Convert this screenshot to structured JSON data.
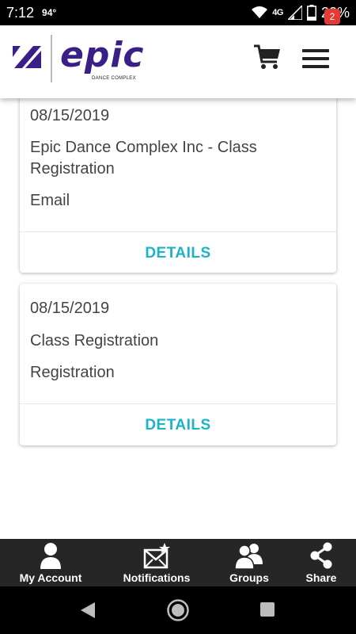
{
  "status_bar": {
    "time": "7:12",
    "temperature": "94°",
    "network": "4G",
    "battery": "22%"
  },
  "header": {
    "logo_text": "epic",
    "logo_subtext": "DANCE COMPLEX",
    "cart_icon": "cart-icon",
    "menu_icon": "hamburger-menu-icon",
    "badge_count": "2"
  },
  "cards": [
    {
      "date": "08/15/2019",
      "title_line1": "Epic Dance Complex Inc - Class",
      "title_line2": "Registration",
      "type": "Email",
      "action": "DETAILS"
    },
    {
      "date": "08/15/2019",
      "title_line1": "Class Registration",
      "type": "Registration",
      "action": "DETAILS"
    }
  ],
  "tabbar": {
    "items": [
      {
        "label": "My Account",
        "icon": "user-icon"
      },
      {
        "label": "Notifications",
        "icon": "envelope-star-icon"
      },
      {
        "label": "Groups",
        "icon": "group-icon"
      },
      {
        "label": "Share",
        "icon": "share-icon"
      }
    ]
  },
  "colors": {
    "brand": "#3a1f86",
    "accent": "#1bb3c6",
    "badge": "#e53935",
    "tabbar": "#262626"
  }
}
